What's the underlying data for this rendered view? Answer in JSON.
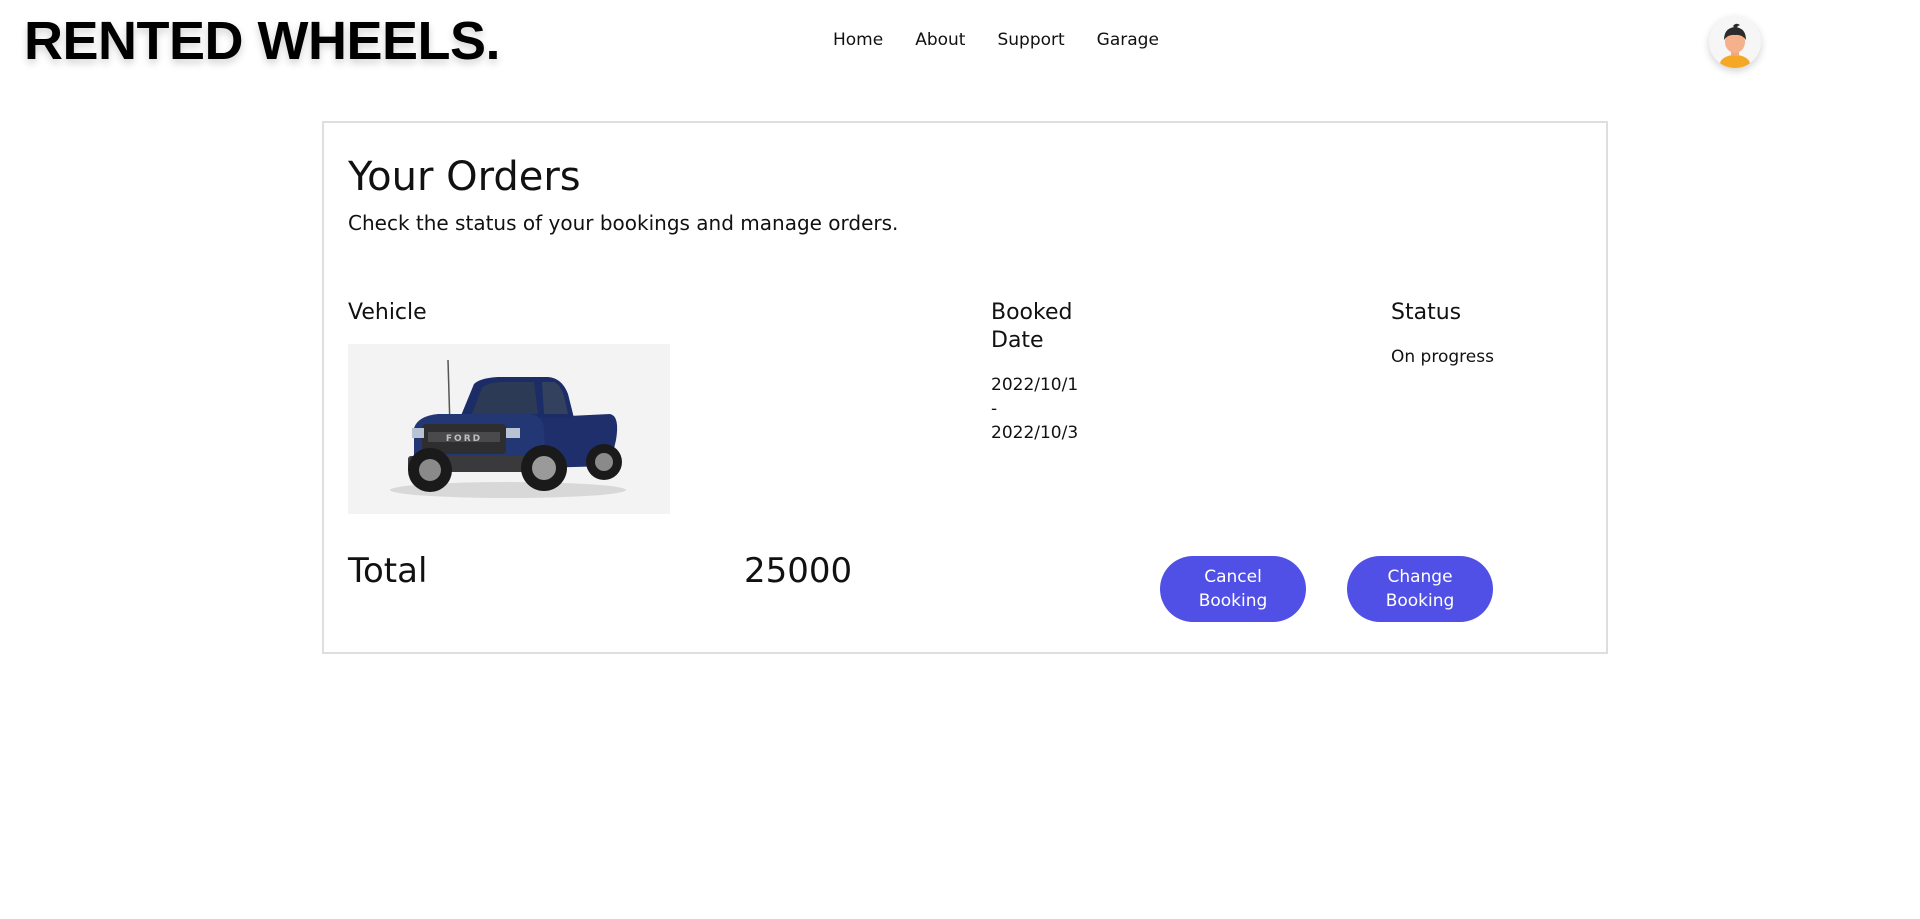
{
  "header": {
    "logo": "RENTED WHEELS.",
    "nav": [
      {
        "label": "Home"
      },
      {
        "label": "About"
      },
      {
        "label": "Support"
      },
      {
        "label": "Garage"
      }
    ],
    "avatar_icon": "user-avatar-icon"
  },
  "orders": {
    "title": "Your Orders",
    "subtitle": "Check the status of your bookings and manage orders.",
    "columns": {
      "vehicle": "Vehicle",
      "booked_date": "Booked Date",
      "status": "Status"
    },
    "order": {
      "vehicle_image": "blue-pickup-truck",
      "date_start": "2022/10/1",
      "date_separator": "-",
      "date_end": "2022/10/3",
      "status": "On progress"
    },
    "total_label": "Total",
    "total_value": "25000",
    "buttons": {
      "cancel": "Cancel Booking",
      "change": "Change Booking"
    }
  },
  "colors": {
    "button": "#5050e6",
    "card_border": "#dedede"
  }
}
